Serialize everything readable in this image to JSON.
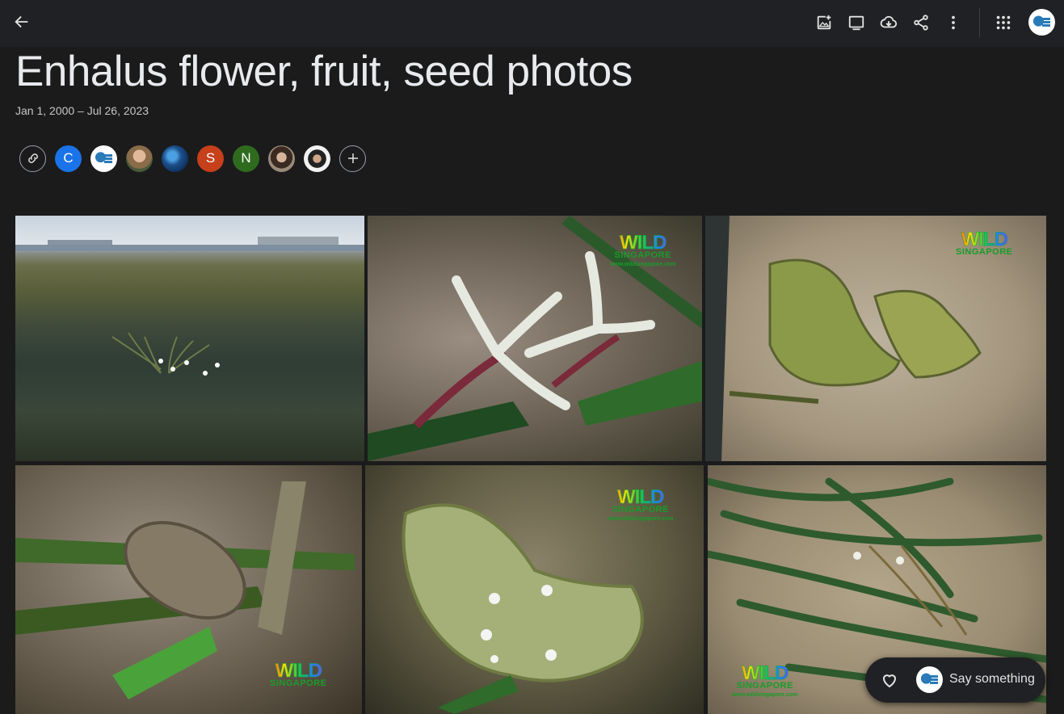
{
  "topbar": {
    "back_icon": "arrow-left-icon",
    "actions": [
      {
        "name": "add-photos",
        "icon": "add-photo-icon"
      },
      {
        "name": "slideshow",
        "icon": "slideshow-icon"
      },
      {
        "name": "download",
        "icon": "cloud-download-icon"
      },
      {
        "name": "share",
        "icon": "share-icon"
      },
      {
        "name": "more-options",
        "icon": "more-vert-icon"
      }
    ],
    "apps_icon": "apps-grid-icon",
    "account_icon": "account-avatar"
  },
  "album": {
    "title": "Enhalus flower, fruit, seed photos",
    "date_range": "Jan 1, 2000 – Jul 26, 2023"
  },
  "people": [
    {
      "initial": "C",
      "color": "#1a73e8"
    },
    {
      "initial": "",
      "color": "#ffffff",
      "kind": "logo"
    },
    {
      "initial": "",
      "color": "#7a6a4f",
      "kind": "photo"
    },
    {
      "initial": "",
      "color": "#1c4f8a",
      "kind": "photo"
    },
    {
      "initial": "S",
      "color": "#c5401b"
    },
    {
      "initial": "N",
      "color": "#2e6b1f"
    },
    {
      "initial": "",
      "color": "#5a4a40",
      "kind": "photo"
    },
    {
      "initial": "",
      "color": "#e8e8e8",
      "kind": "photo"
    }
  ],
  "watermark": {
    "big": "WILD",
    "mid": "SINGAPORE",
    "url": "www.wildsingapore.com"
  },
  "comment_bar": {
    "placeholder": "Say something",
    "heart_icon": "heart-outline-icon"
  }
}
